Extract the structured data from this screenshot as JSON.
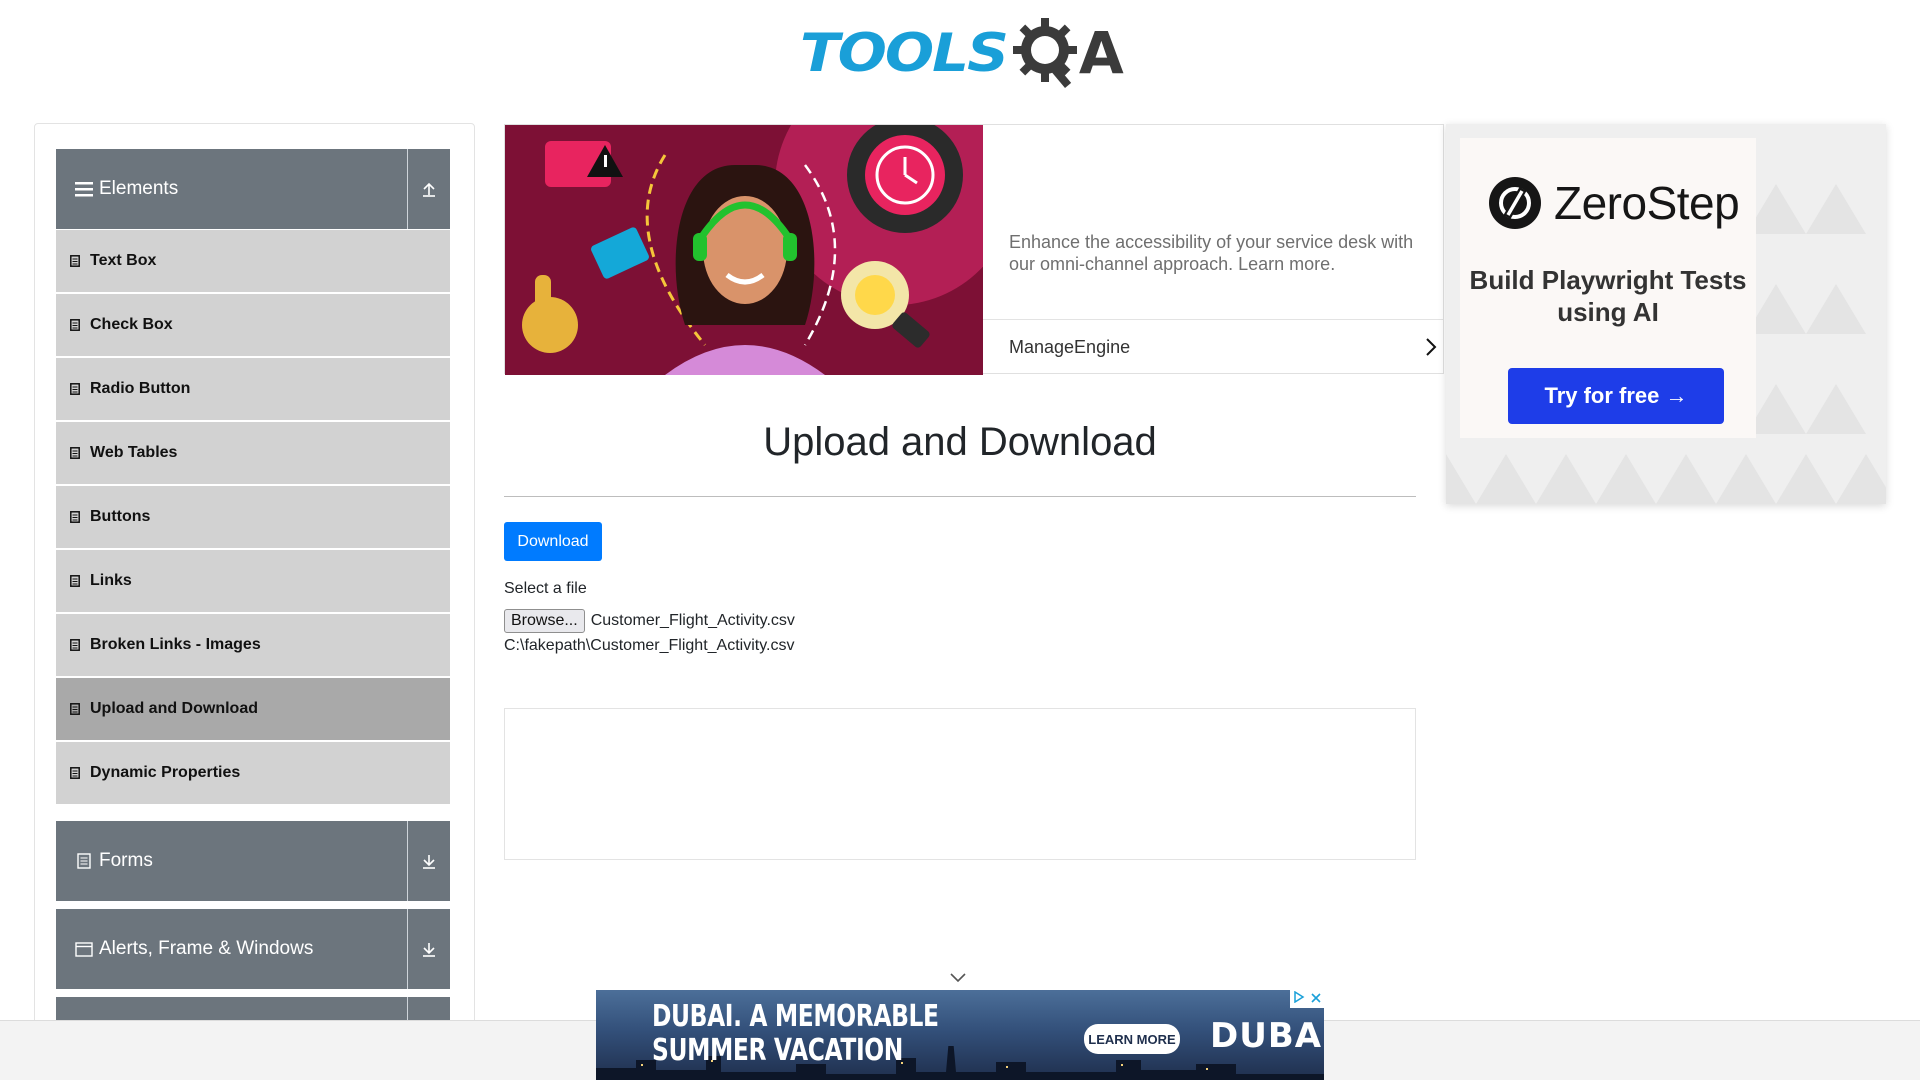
{
  "brand": {
    "logo_text": "TOOLSQA",
    "logo_tools": "TOOLS",
    "logo_a": "A",
    "colors": {
      "tools_blue": "#1a9fd8",
      "qa_dark": "#3b3b3b"
    }
  },
  "sidebar": {
    "groups": [
      {
        "label": "Elements",
        "icon": "hamburger-icon",
        "toggle_icon": "collapse-up-icon"
      },
      {
        "label": "Forms",
        "icon": "form-icon",
        "toggle_icon": "expand-down-icon"
      },
      {
        "label": "Alerts, Frame & Windows",
        "icon": "window-icon",
        "toggle_icon": "expand-down-icon"
      }
    ],
    "items": [
      {
        "label": "Text Box"
      },
      {
        "label": "Check Box"
      },
      {
        "label": "Radio Button"
      },
      {
        "label": "Web Tables"
      },
      {
        "label": "Buttons"
      },
      {
        "label": "Links"
      },
      {
        "label": "Broken Links - Images"
      },
      {
        "label": "Upload and Download",
        "active": true
      },
      {
        "label": "Dynamic Properties"
      }
    ],
    "colors": {
      "header_bg": "#6c757d",
      "item_bg": "#d2d2d2",
      "active_bg": "#a9a9a9"
    }
  },
  "top_ad": {
    "description": "Enhance the accessibility of your service desk with our omni-channel approach. Learn more.",
    "advertiser": "ManageEngine"
  },
  "main": {
    "title": "Upload and Download",
    "download_label": "Download",
    "select_label": "Select a file",
    "browse_label": "Browse...",
    "file_name": "Customer_Flight_Activity.csv",
    "uploaded_path": "C:\\fakepath\\Customer_Flight_Activity.csv",
    "colors": {
      "download_bg": "#007bff"
    }
  },
  "right_ad": {
    "brand": "ZeroStep",
    "headline": "Build Playwright Tests using AI",
    "cta": "Try for free →",
    "colors": {
      "cta_bg": "#1e3de8"
    }
  },
  "bottom_ad": {
    "headline_line1": "DUBAI. A MEMORABLE",
    "headline_line2": "SUMMER VACATION",
    "cta": "LEARN MORE",
    "logo": "DUBAI"
  }
}
